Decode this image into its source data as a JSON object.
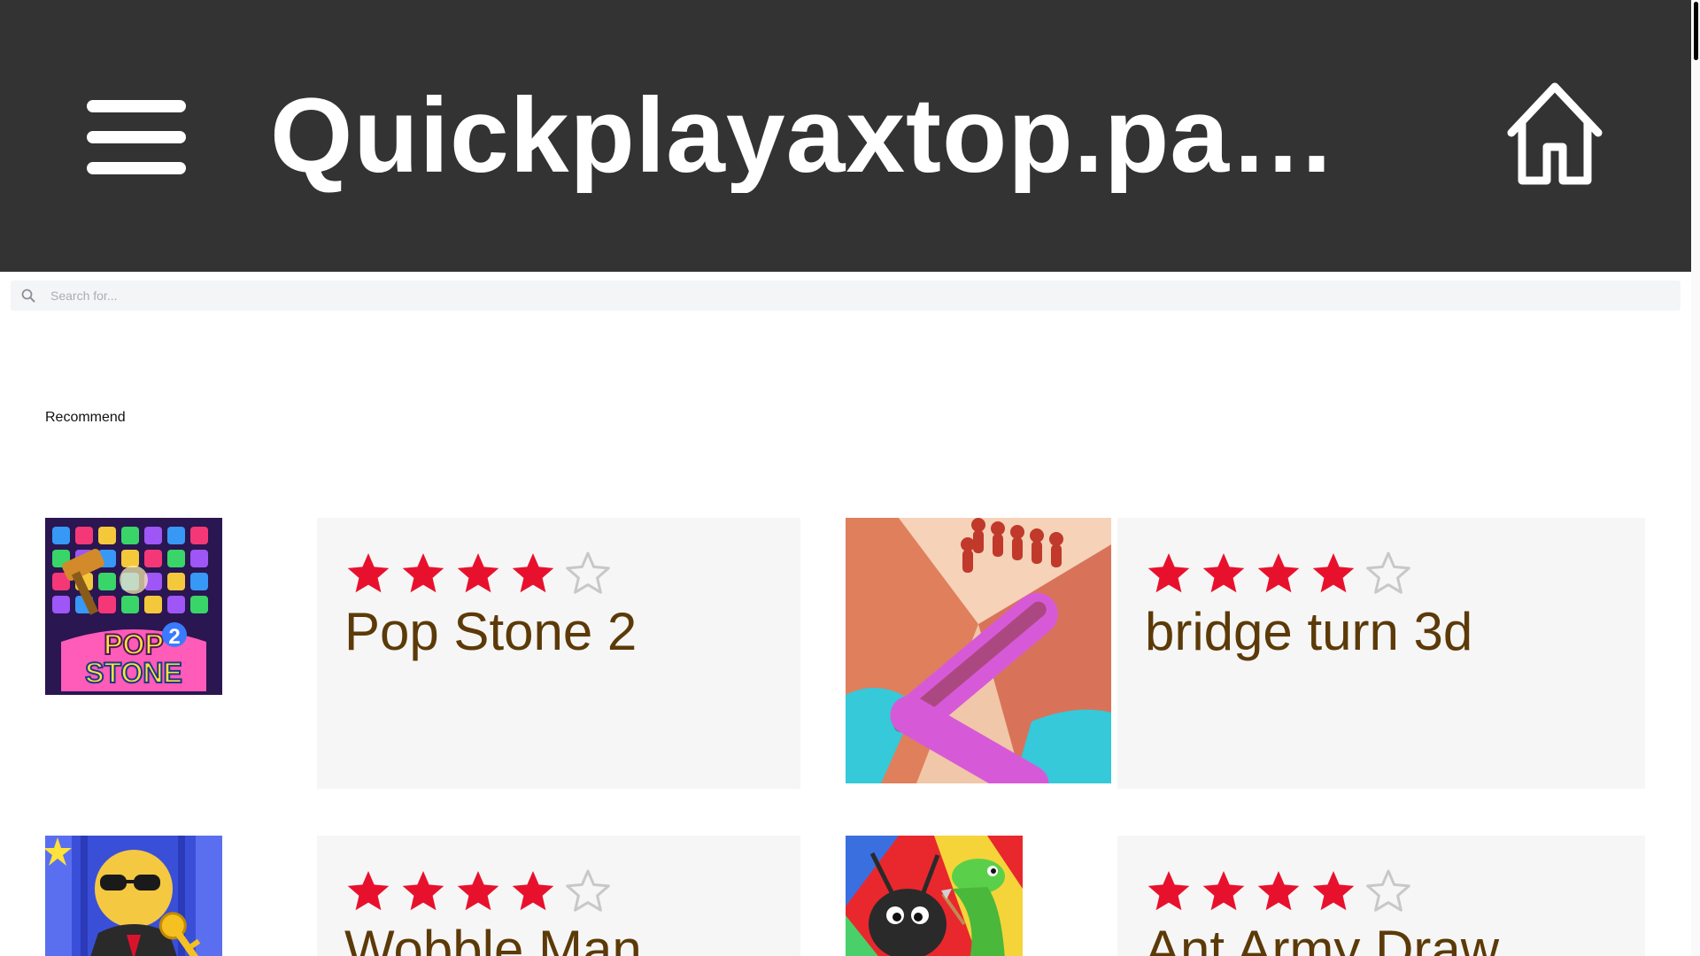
{
  "header": {
    "title": "Quickplayaxtop.page…"
  },
  "search": {
    "placeholder": "Search for..."
  },
  "section": {
    "title": "Recommend"
  },
  "games": [
    {
      "name": "Pop Stone 2",
      "rating": 4,
      "max_rating": 5
    },
    {
      "name": "bridge turn 3d",
      "rating": 4,
      "max_rating": 5
    },
    {
      "name": "Wobble Man",
      "rating": 4,
      "max_rating": 5
    },
    {
      "name": "Ant Army Draw",
      "rating": 4,
      "max_rating": 5
    }
  ],
  "colors": {
    "header_bg": "#333333",
    "star_filled": "#e8112d",
    "game_name": "#5c3a08",
    "card_bg": "#f6f6f6"
  },
  "icons": {
    "menu": "hamburger-icon",
    "home": "home-icon",
    "search": "search-icon",
    "star": "star-icon"
  }
}
